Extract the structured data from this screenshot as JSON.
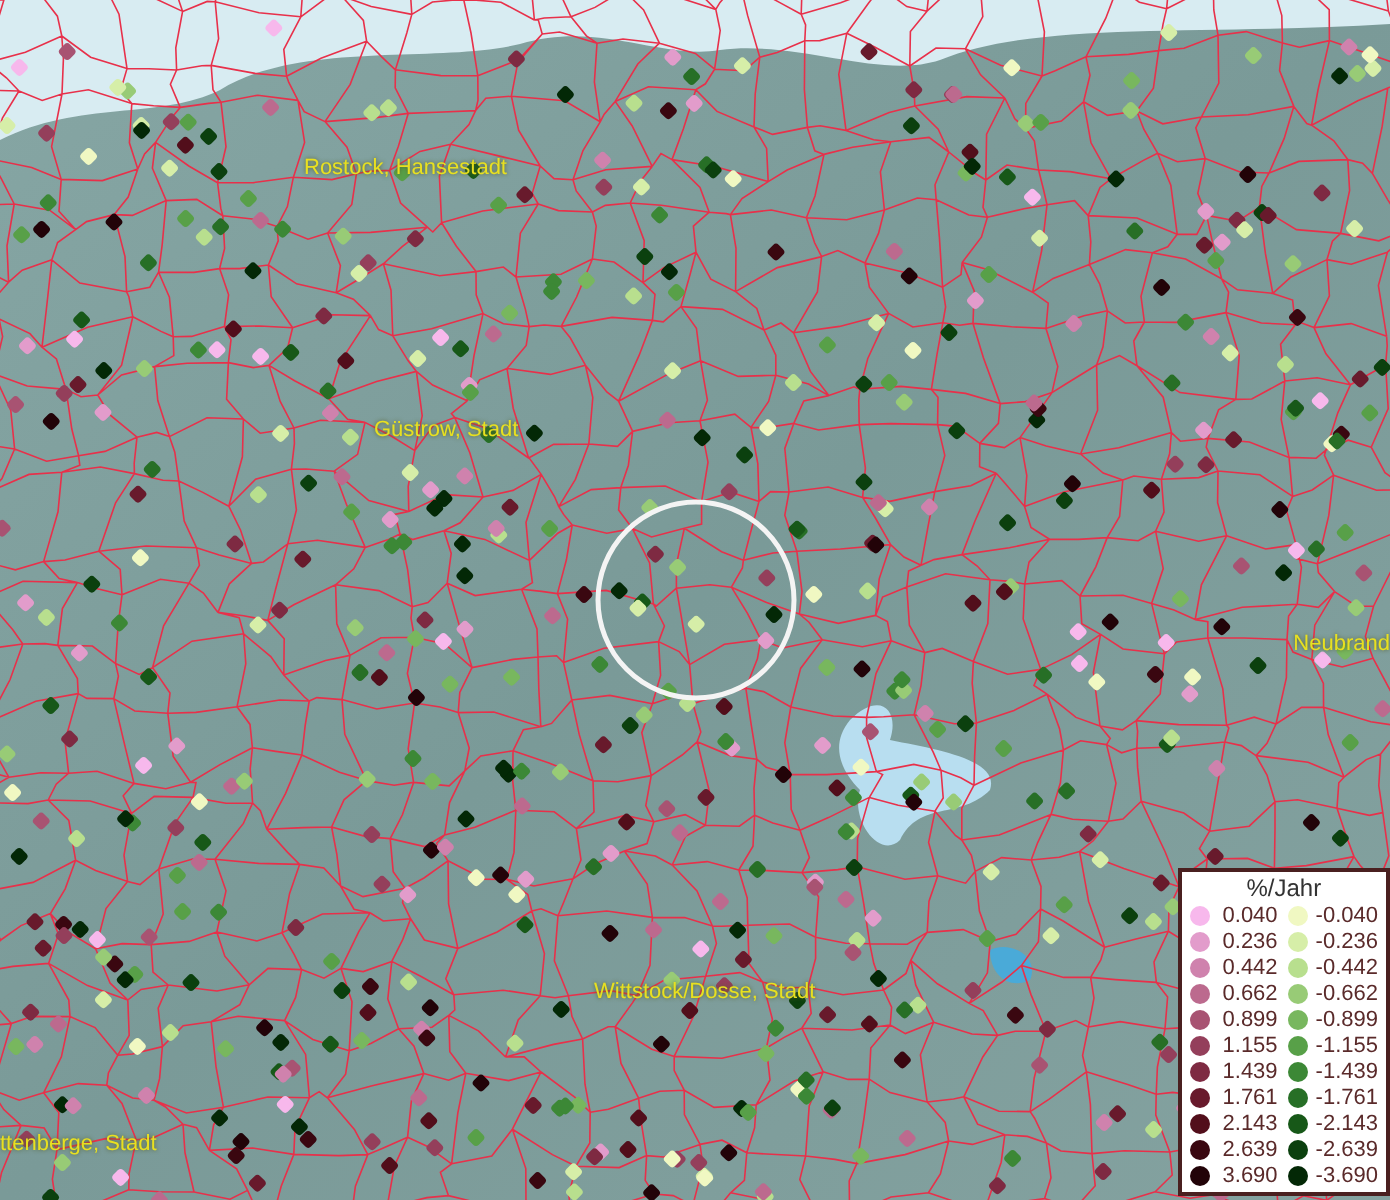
{
  "map": {
    "places": [
      {
        "name": "Rostock, Hansestadt"
      },
      {
        "name": "Güstrow, Stadt"
      },
      {
        "name": "Neubrand"
      },
      {
        "name": "Wittstock/Dosse, Stadt"
      },
      {
        "name": "ttenberge, Stadt"
      }
    ]
  },
  "legend": {
    "title": "%/Jahr",
    "columns": [
      [
        {
          "value": "0.040",
          "color": "#f7b8ec"
        },
        {
          "value": "0.236",
          "color": "#e29ccb"
        },
        {
          "value": "0.442",
          "color": "#cf82ad"
        },
        {
          "value": "0.662",
          "color": "#bc6a8e"
        },
        {
          "value": "0.899",
          "color": "#a85372"
        },
        {
          "value": "1.155",
          "color": "#943f5b"
        },
        {
          "value": "1.439",
          "color": "#7e2a42"
        },
        {
          "value": "1.761",
          "color": "#681a2c"
        },
        {
          "value": "2.143",
          "color": "#520e1b"
        },
        {
          "value": "2.639",
          "color": "#3a0710"
        },
        {
          "value": "3.690",
          "color": "#220308"
        }
      ],
      [
        {
          "value": "-0.040",
          "color": "#f0f8c2"
        },
        {
          "value": "-0.236",
          "color": "#d6eea8"
        },
        {
          "value": "-0.442",
          "color": "#b8df8e"
        },
        {
          "value": "-0.662",
          "color": "#98cb76"
        },
        {
          "value": "-0.899",
          "color": "#78b75e"
        },
        {
          "value": "-1.155",
          "color": "#58a048"
        },
        {
          "value": "-1.439",
          "color": "#3c8836"
        },
        {
          "value": "-1.761",
          "color": "#276f26"
        },
        {
          "value": "-2.143",
          "color": "#175818"
        },
        {
          "value": "-2.639",
          "color": "#0b400e"
        },
        {
          "value": "-3.690",
          "color": "#032806"
        }
      ]
    ]
  }
}
